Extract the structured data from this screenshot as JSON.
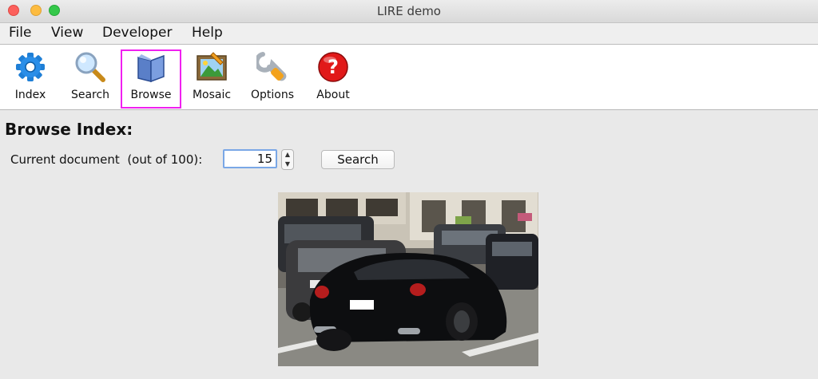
{
  "window": {
    "title": "LIRE demo"
  },
  "menu": [
    "File",
    "View",
    "Developer",
    "Help"
  ],
  "toolbar": [
    {
      "label": "Index",
      "icon": "gear-icon"
    },
    {
      "label": "Search",
      "icon": "magnifier-icon"
    },
    {
      "label": "Browse",
      "icon": "book-icon",
      "selected": true
    },
    {
      "label": "Mosaic",
      "icon": "picture-icon"
    },
    {
      "label": "Options",
      "icon": "wrench-icon"
    },
    {
      "label": "About",
      "icon": "help-icon"
    }
  ],
  "browse": {
    "heading": "Browse Index:",
    "current_label": "Current document  (out of 100):",
    "current_value": "15",
    "search_label": "Search"
  },
  "colors": {
    "selection": "#f020f0",
    "input_focus": "#7aa7e6"
  }
}
